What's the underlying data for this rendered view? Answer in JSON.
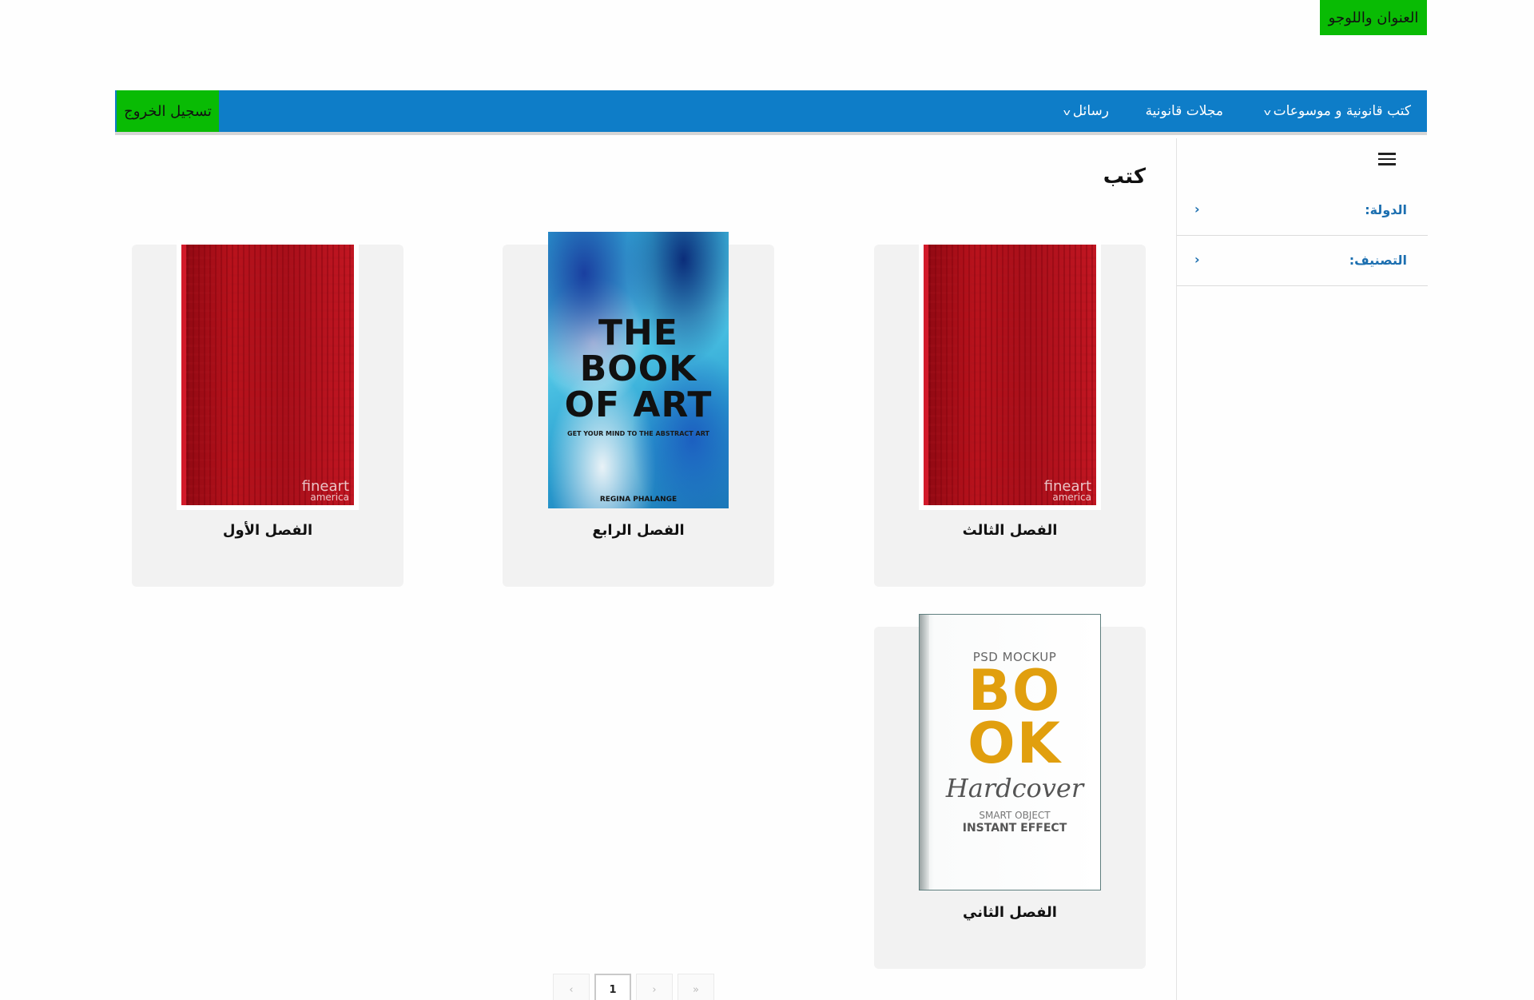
{
  "header": {
    "logo_text": "العنوان واللوجو"
  },
  "navbar": {
    "logout_label": "تسجيل الخروج",
    "items": [
      {
        "label": "كتب قانونية و موسوعات",
        "has_dropdown": true
      },
      {
        "label": "مجلات قانونية",
        "has_dropdown": false
      },
      {
        "label": "رسائل",
        "has_dropdown": true
      }
    ]
  },
  "sidebar": {
    "filters": [
      {
        "label": "الدولة:"
      },
      {
        "label": "التصنيف:"
      }
    ]
  },
  "main": {
    "title": "كتب",
    "books": [
      {
        "title": "الفصل الثالث",
        "cover": "red-fineart",
        "brand_top": "fineart",
        "brand_bottom": "america"
      },
      {
        "title": "الفصل الرابع",
        "cover": "book-of-art",
        "cover_title_1": "THE",
        "cover_title_2": "BOOK",
        "cover_title_3": "OF ART",
        "cover_subtitle": "GET YOUR MIND TO THE ABSTRACT ART",
        "cover_author": "REGINA PHALANGE"
      },
      {
        "title": "الفصل الأول",
        "cover": "red-fineart",
        "brand_top": "fineart",
        "brand_bottom": "america"
      },
      {
        "title": "الفصل الثاني",
        "cover": "psd-mockup",
        "line1": "PSD MOCKUP",
        "line2": "BO",
        "line3": "OK",
        "line4": "Hardcover",
        "line5": "SMART OBJECT",
        "line6": "INSTANT EFFECT"
      }
    ]
  },
  "pagination": {
    "first": "‹",
    "current": "1",
    "next": "›",
    "last": "»"
  }
}
